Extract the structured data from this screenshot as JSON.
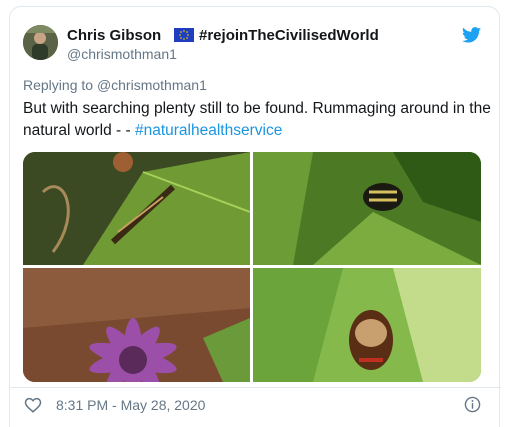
{
  "author": {
    "display_name": "Chris Gibson",
    "flag_icon": "eu-flag-icon",
    "name_hashtag": "#rejoinTheCivilisedWorld",
    "handle": "@chrismothman1"
  },
  "reply": {
    "prefix": "Replying to",
    "mention": "@chrismothman1"
  },
  "tweet": {
    "text": "But with searching plenty still to be found. Rummaging around in the natural world - - ",
    "hashtag": "#naturalhealthservice"
  },
  "media": {
    "photos": [
      {
        "subject": "scorpionfly-on-leaf-photo"
      },
      {
        "subject": "beetle-on-leaf-photo"
      },
      {
        "subject": "purple-flower-photo"
      },
      {
        "subject": "shield-bug-on-leaf-photo"
      }
    ]
  },
  "footer": {
    "timestamp": "8:31 PM - May 28, 2020"
  },
  "colors": {
    "link": "#1b95e0",
    "twitter_blue": "#1da1f2",
    "secondary_text": "#657786"
  }
}
